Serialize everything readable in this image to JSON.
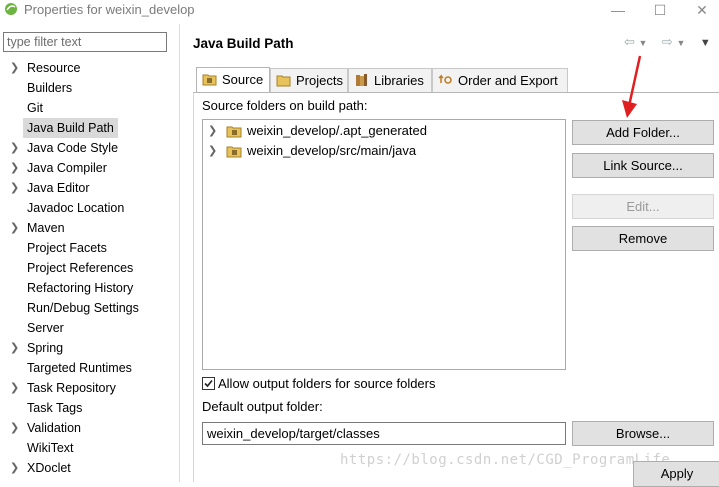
{
  "window": {
    "title": "Properties for weixin_develop",
    "min_glyph": "—",
    "max_glyph": "☐",
    "close_glyph": "✕"
  },
  "filter": {
    "placeholder": "type filter text"
  },
  "nav": {
    "items": [
      {
        "label": "Resource",
        "expandable": true
      },
      {
        "label": "Builders",
        "expandable": false
      },
      {
        "label": "Git",
        "expandable": false
      },
      {
        "label": "Java Build Path",
        "expandable": false,
        "selected": true
      },
      {
        "label": "Java Code Style",
        "expandable": true
      },
      {
        "label": "Java Compiler",
        "expandable": true
      },
      {
        "label": "Java Editor",
        "expandable": true
      },
      {
        "label": "Javadoc Location",
        "expandable": false
      },
      {
        "label": "Maven",
        "expandable": true
      },
      {
        "label": "Project Facets",
        "expandable": false
      },
      {
        "label": "Project References",
        "expandable": false
      },
      {
        "label": "Refactoring History",
        "expandable": false
      },
      {
        "label": "Run/Debug Settings",
        "expandable": false
      },
      {
        "label": "Server",
        "expandable": false
      },
      {
        "label": "Spring",
        "expandable": true
      },
      {
        "label": "Targeted Runtimes",
        "expandable": false
      },
      {
        "label": "Task Repository",
        "expandable": true
      },
      {
        "label": "Task Tags",
        "expandable": false
      },
      {
        "label": "Validation",
        "expandable": true
      },
      {
        "label": "WikiText",
        "expandable": false
      },
      {
        "label": "XDoclet",
        "expandable": true
      }
    ]
  },
  "page": {
    "title": "Java Build Path",
    "tabs": [
      {
        "label": "Source",
        "active": true
      },
      {
        "label": "Projects"
      },
      {
        "label": "Libraries"
      },
      {
        "label": "Order and Export"
      }
    ],
    "source_label": "Source folders on build path:",
    "source_folders": [
      "weixin_develop/.apt_generated",
      "weixin_develop/src/main/java"
    ],
    "buttons": {
      "add_folder": "Add Folder...",
      "link_source": "Link Source...",
      "edit": "Edit...",
      "remove": "Remove",
      "browse": "Browse...",
      "apply": "Apply"
    },
    "allow_output_label": "Allow output folders for source folders",
    "allow_output_checked": true,
    "default_output_label": "Default output folder:",
    "default_output_value": "weixin_develop/target/classes"
  },
  "watermark": "https://blog.csdn.net/CGD_ProgramLife",
  "colors": {
    "annotation_arrow": "#e02020",
    "selection": "#d9d9d9"
  }
}
